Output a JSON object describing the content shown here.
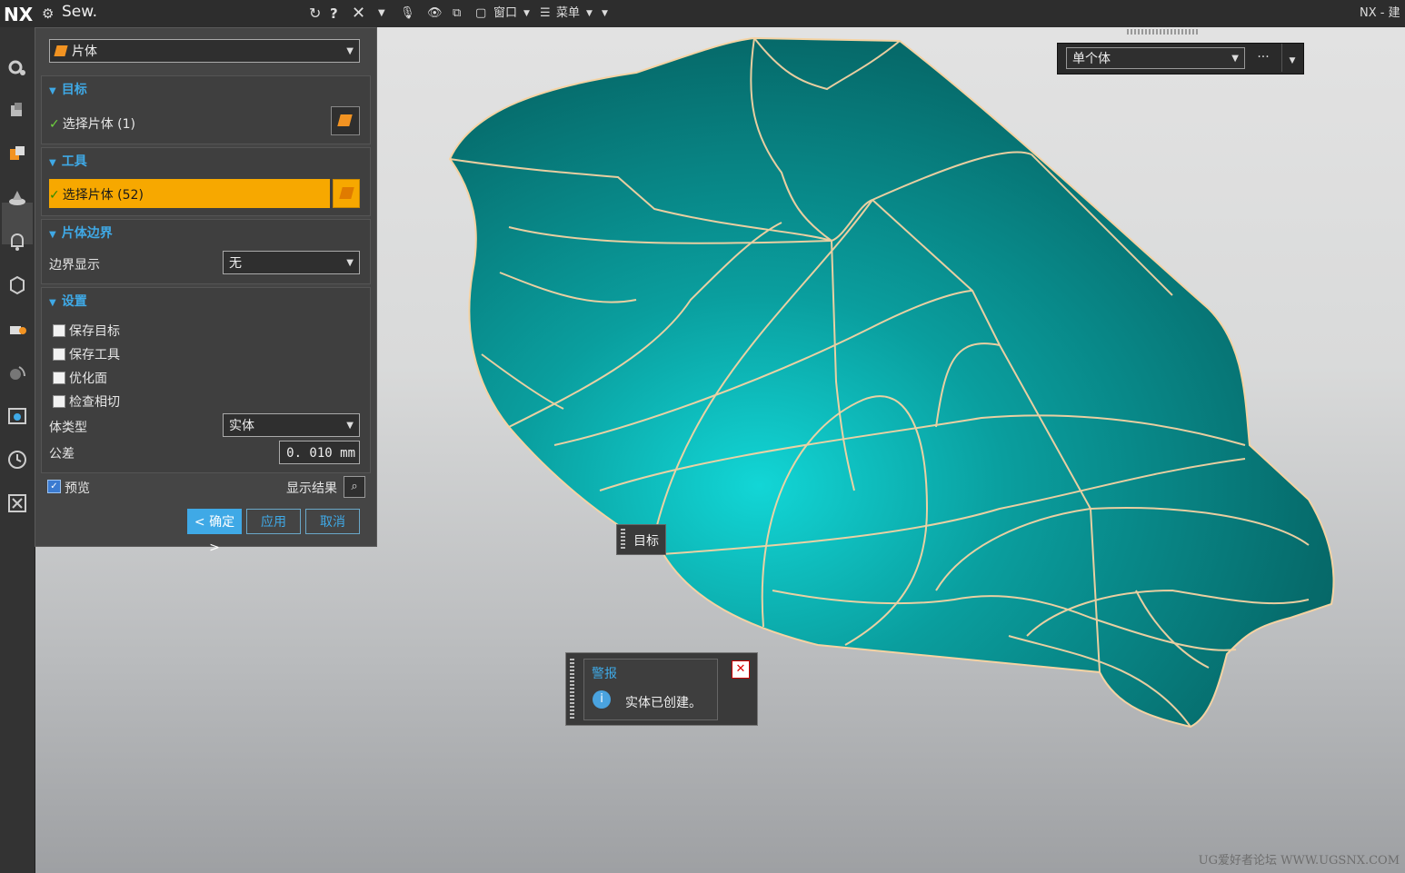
{
  "titlebar": {
    "logo": "NX",
    "title": "Sew.",
    "window_menu": "窗口",
    "menu": "菜单",
    "app_title": "NX - 建"
  },
  "dialog": {
    "type_select": "片体",
    "target": {
      "header": "目标",
      "select_label": "选择片体 (1)"
    },
    "tool": {
      "header": "工具",
      "select_label": "选择片体 (52)"
    },
    "sheet_boundary": {
      "header": "片体边界",
      "display_label": "边界显示",
      "display_value": "无"
    },
    "settings": {
      "header": "设置",
      "checkboxes": [
        {
          "label": "保存目标",
          "checked": false
        },
        {
          "label": "保存工具",
          "checked": false
        },
        {
          "label": "优化面",
          "checked": false
        },
        {
          "label": "检查相切",
          "checked": false
        }
      ],
      "body_type_label": "体类型",
      "body_type_value": "实体",
      "tolerance_label": "公差",
      "tolerance_value": "0. 010 mm"
    },
    "preview_label": "预览",
    "preview_checked": true,
    "show_result_label": "显示结果",
    "buttons": {
      "ok": "< 确定 >",
      "apply": "应用",
      "cancel": "取消"
    }
  },
  "selection_filter": {
    "value": "单个体",
    "more": "···"
  },
  "target_tag": "目标",
  "alert": {
    "title": "警报",
    "message": "实体已创建。"
  },
  "watermark": "UG爱好者论坛 WWW.UGSNX.COM",
  "colors": {
    "accent": "#3fa9e6",
    "highlight": "#f7a800",
    "model": "#0a8f8f",
    "edges": "#f5d3a3"
  }
}
